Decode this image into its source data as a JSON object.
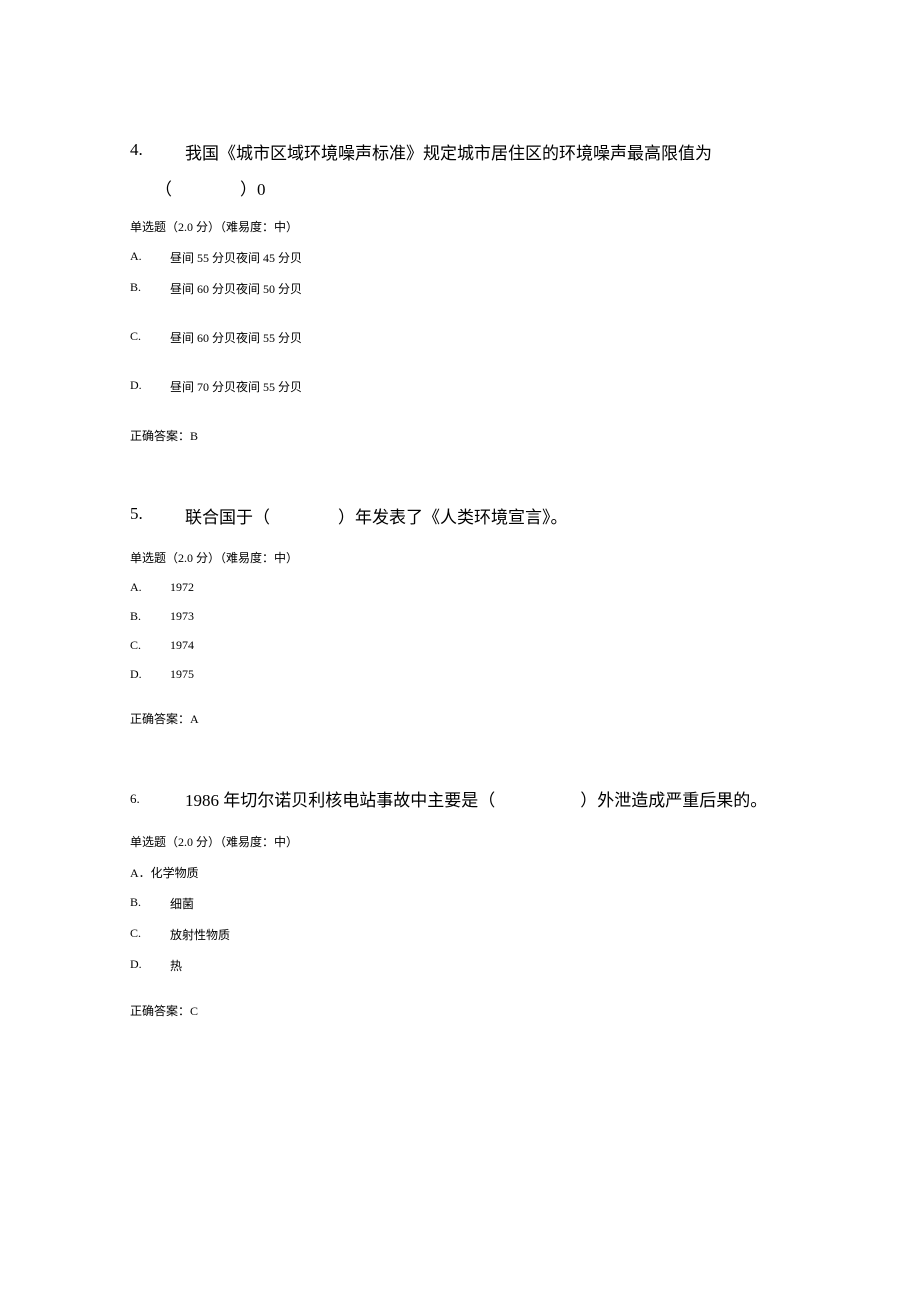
{
  "questions": [
    {
      "number": "4.",
      "text": "我国《城市区域环境噪声标准》规定城市居住区的环境噪声最高限值为",
      "sub": "（　　　　）0",
      "meta": "单选题（2.0 分）（难易度：中）",
      "options": [
        {
          "letter": "A.",
          "text": "昼间 55 分贝夜间 45 分贝"
        },
        {
          "letter": "B.",
          "text": "昼间 60 分贝夜间 50 分贝"
        },
        {
          "letter": "C.",
          "text": "昼间 60 分贝夜间 55 分贝"
        },
        {
          "letter": "D.",
          "text": "昼间 70 分贝夜间 55 分贝"
        }
      ],
      "answer": "正确答案：B"
    },
    {
      "number": "5.",
      "text": "联合国于（　　　　）年发表了《人类环境宣言》。",
      "meta": "单选题（2.0 分）（难易度：中）",
      "options": [
        {
          "letter": "A.",
          "text": "1972"
        },
        {
          "letter": "B.",
          "text": "1973"
        },
        {
          "letter": "C.",
          "text": "1974"
        },
        {
          "letter": "D.",
          "text": "1975"
        }
      ],
      "answer": "正确答案：A"
    },
    {
      "number": "6.",
      "text": "1986 年切尔诺贝利核电站事故中主要是（　　　　　）外泄造成严重后果的。",
      "meta": "单选题（2.0 分）（难易度：中）",
      "options": [
        {
          "letter": "A．",
          "text": "化学物质",
          "inline": true
        },
        {
          "letter": "B.",
          "text": "细菌"
        },
        {
          "letter": "C.",
          "text": "放射性物质"
        },
        {
          "letter": "D.",
          "text": "热"
        }
      ],
      "answer": "正确答案：C"
    }
  ]
}
